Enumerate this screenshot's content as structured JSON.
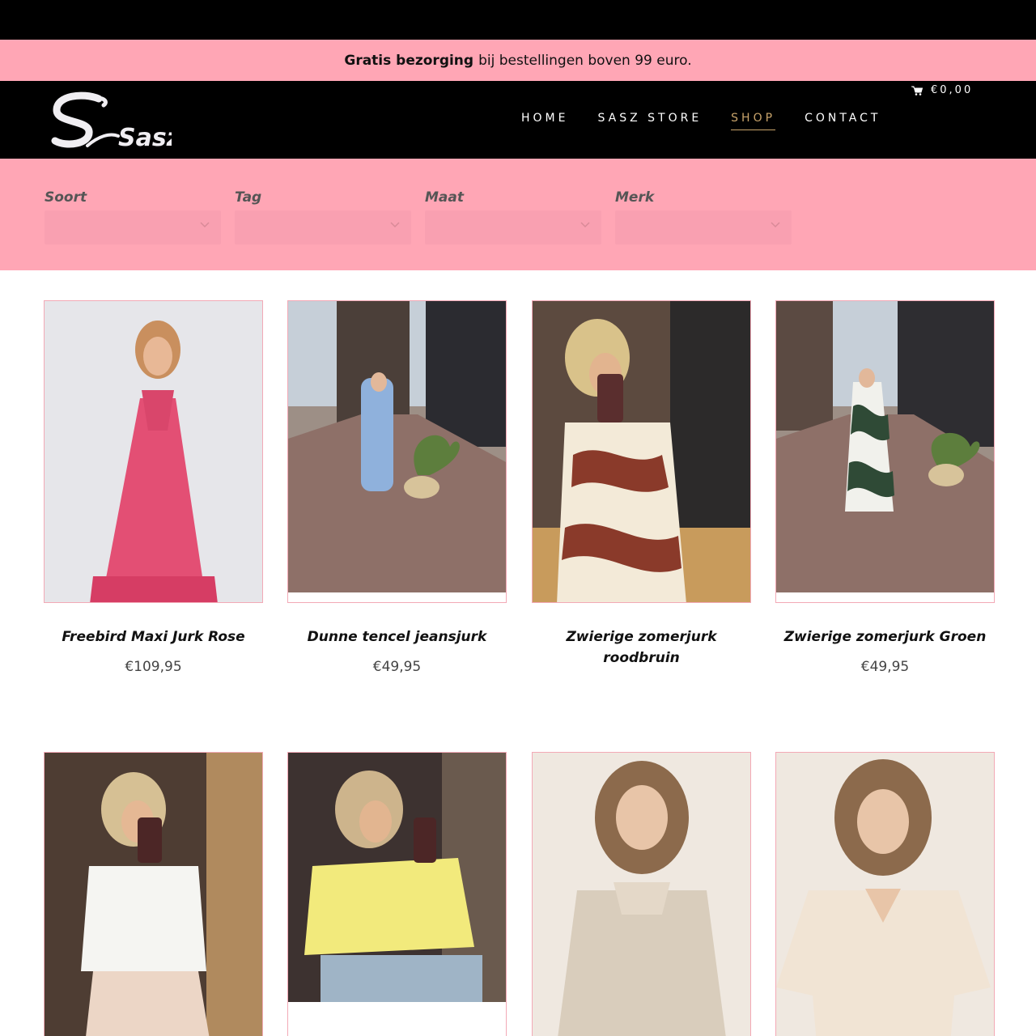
{
  "promo": {
    "bold": "Gratis bezorging",
    "rest": "bij bestellingen boven 99 euro."
  },
  "header": {
    "logo_text": "Sasz",
    "cart_total": "€0,00",
    "cart_icon": "cart-icon",
    "nav": [
      {
        "label": "HOME",
        "active": false
      },
      {
        "label": "SASZ STORE",
        "active": false
      },
      {
        "label": "SHOP",
        "active": true
      },
      {
        "label": "CONTACT",
        "active": false
      }
    ]
  },
  "filters": [
    {
      "label": "Soort",
      "value": ""
    },
    {
      "label": "Tag",
      "value": ""
    },
    {
      "label": "Maat",
      "value": ""
    },
    {
      "label": "Merk",
      "value": ""
    }
  ],
  "products": [
    {
      "name": "Freebird Maxi Jurk Rose",
      "price": "€109,95"
    },
    {
      "name": "Dunne tencel jeansjurk",
      "price": "€49,95"
    },
    {
      "name": "Zwierige zomerjurk roodbruin",
      "price": ""
    },
    {
      "name": "Zwierige zomerjurk Groen",
      "price": "€49,95"
    },
    {
      "name": "",
      "price": ""
    },
    {
      "name": "",
      "price": ""
    },
    {
      "name": "",
      "price": ""
    },
    {
      "name": "",
      "price": ""
    }
  ],
  "colors": {
    "pink": "#ffa6b5",
    "black": "#000000",
    "gold": "#c9a46b"
  }
}
